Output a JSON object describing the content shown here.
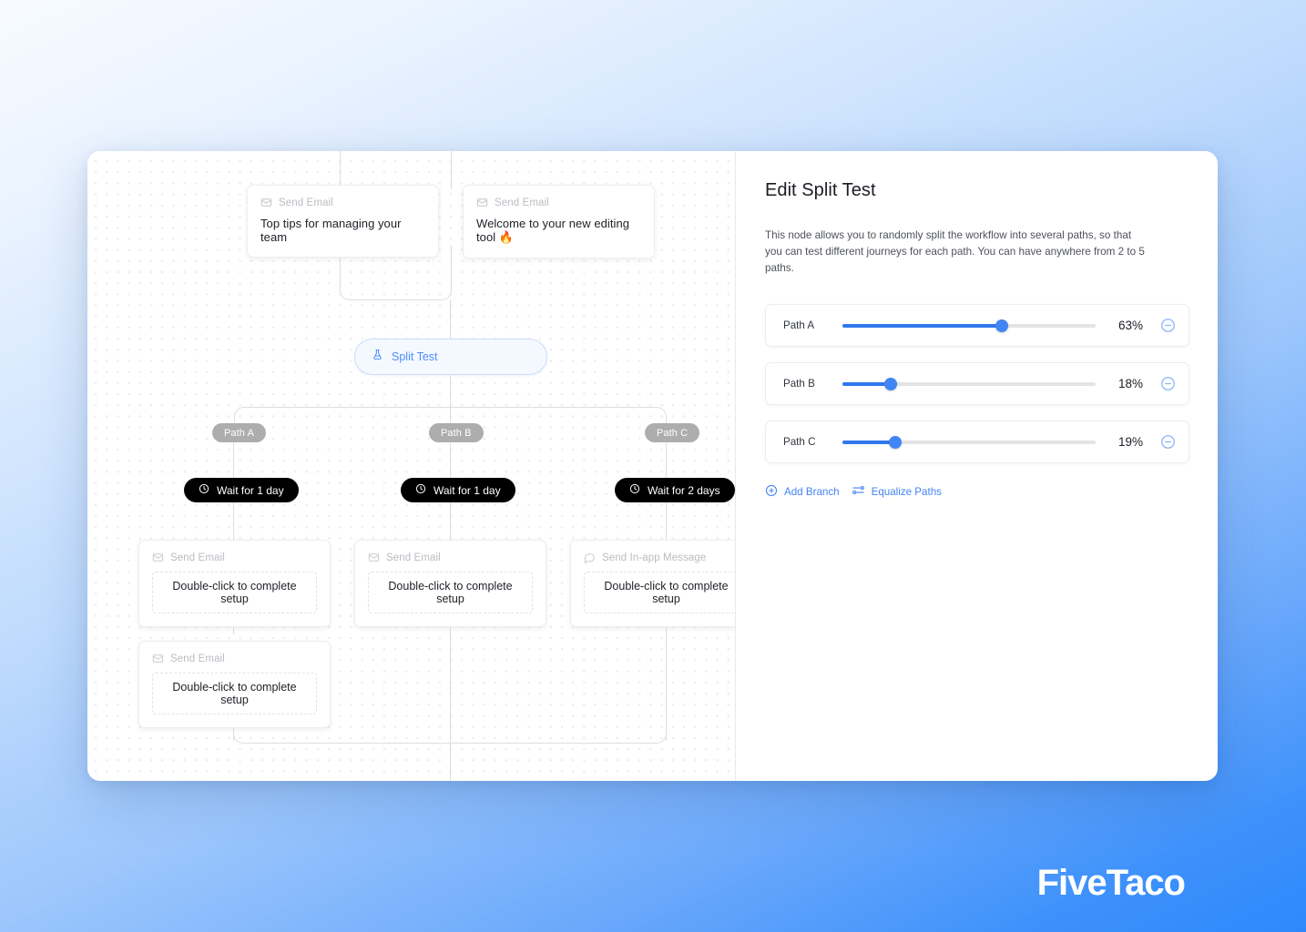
{
  "brand": {
    "watermark": "FiveTaco"
  },
  "canvas": {
    "top_nodes": [
      {
        "type_label": "Send Email",
        "icon": "envelope-icon",
        "title": "Top tips for managing your team"
      },
      {
        "type_label": "Send Email",
        "icon": "envelope-icon",
        "title": "Welcome to your new editing tool 🔥"
      }
    ],
    "split_node": {
      "label": "Split Test",
      "icon": "flask-icon"
    },
    "path_pills": [
      {
        "label": "Path A"
      },
      {
        "label": "Path B"
      },
      {
        "label": "Path C"
      }
    ],
    "wait_nodes": [
      {
        "label": "Wait for 1 day",
        "icon": "clock-icon"
      },
      {
        "label": "Wait for 1 day",
        "icon": "clock-icon"
      },
      {
        "label": "Wait for 2 days",
        "icon": "clock-icon"
      }
    ],
    "action_nodes": [
      {
        "type_label": "Send Email",
        "icon": "envelope-icon",
        "placeholder": "Double-click to complete setup"
      },
      {
        "type_label": "Send Email",
        "icon": "envelope-icon",
        "placeholder": "Double-click to complete setup"
      },
      {
        "type_label": "Send In-app Message",
        "icon": "chat-bubble-icon",
        "placeholder": "Double-click to complete setup"
      },
      {
        "type_label": "Send Email",
        "icon": "envelope-icon",
        "placeholder": "Double-click to complete setup"
      }
    ]
  },
  "panel": {
    "title": "Edit Split Test",
    "description": "This node allows you to randomly split the workflow into several paths, so that you can test different journeys for each path. You can have anywhere from 2 to 5 paths.",
    "sliders": [
      {
        "label": "Path A",
        "value": 63,
        "value_label": "63%",
        "remove_icon": "minus-circle-icon"
      },
      {
        "label": "Path B",
        "value": 18,
        "value_label": "18%",
        "remove_icon": "minus-circle-icon"
      },
      {
        "label": "Path C",
        "value": 19,
        "value_label": "19%",
        "remove_icon": "minus-circle-icon"
      }
    ],
    "actions": [
      {
        "label": "Add Branch",
        "icon": "plus-circle-icon"
      },
      {
        "label": "Equalize Paths",
        "icon": "equalizer-icon"
      }
    ]
  },
  "colors": {
    "accent": "#4285f4",
    "slider_fill": "#2f78ee",
    "wait_pill_bg": "#000000",
    "path_pill_bg": "#adadad",
    "background_top": "#f7fbff",
    "background_bottom": "#2f88fb"
  }
}
